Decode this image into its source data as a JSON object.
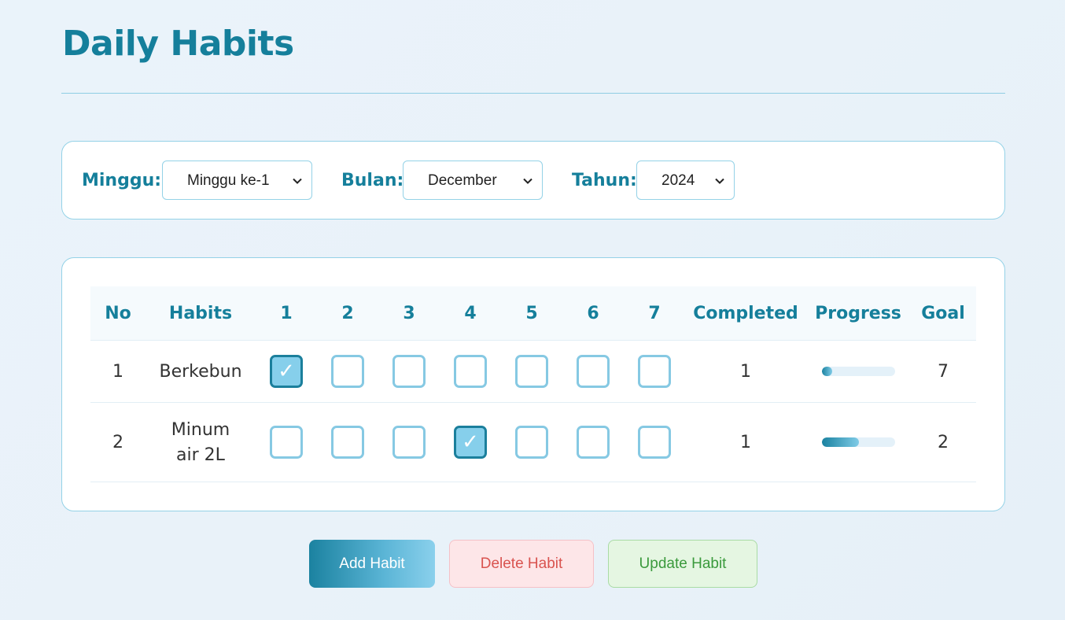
{
  "page": {
    "title": "Daily Habits"
  },
  "filters": {
    "week": {
      "label": "Minggu:",
      "value": "Minggu ke-1"
    },
    "month": {
      "label": "Bulan:",
      "value": "December"
    },
    "year": {
      "label": "Tahun:",
      "value": "2024"
    }
  },
  "table": {
    "headers": [
      "No",
      "Habits",
      "1",
      "2",
      "3",
      "4",
      "5",
      "6",
      "7",
      "Completed",
      "Progress",
      "Goal"
    ],
    "rows": [
      {
        "no": "1",
        "habit": "Berkebun",
        "habit_line2": "",
        "checks": [
          true,
          false,
          false,
          false,
          false,
          false,
          false
        ],
        "completed": "1",
        "progress": 0.1429,
        "goal": "7"
      },
      {
        "no": "2",
        "habit": "Minum",
        "habit_line2": "air 2L",
        "checks": [
          false,
          false,
          false,
          true,
          false,
          false,
          false
        ],
        "completed": "1",
        "progress": 0.5,
        "goal": "2"
      }
    ]
  },
  "actions": {
    "add_label": "Add Habit",
    "delete_label": "Delete Habit",
    "update_label": "Update Habit"
  },
  "colors": {
    "accent": "#157f9b",
    "checkbox_border": "#86c9e3",
    "checkbox_checked": "#86cfeb"
  },
  "icons": {
    "select_arrow": "chevron-down-icon",
    "check": "check-icon"
  }
}
